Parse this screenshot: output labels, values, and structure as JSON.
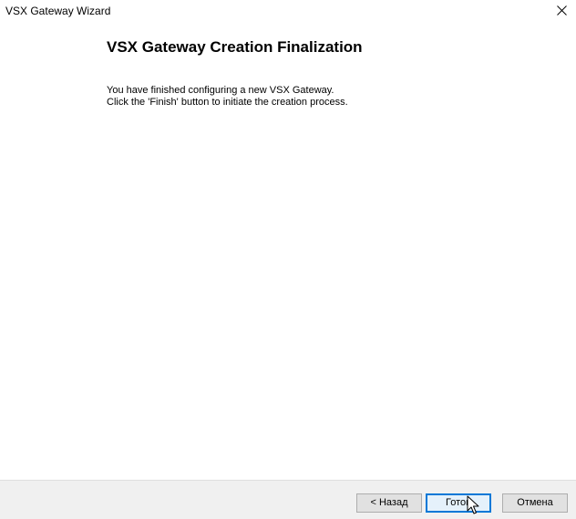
{
  "window": {
    "title": "VSX Gateway Wizard",
    "close_icon": "close-icon"
  },
  "page": {
    "heading": "VSX Gateway Creation Finalization",
    "lines": [
      "You have finished configuring a new VSX Gateway.",
      "Click the 'Finish' button to initiate the creation process."
    ]
  },
  "footer": {
    "back_label": "< Назад",
    "finish_label": "Готов",
    "cancel_label": "Отмена"
  },
  "colors": {
    "accent": "#0078d7",
    "footer_bg": "#f0f0f0"
  }
}
